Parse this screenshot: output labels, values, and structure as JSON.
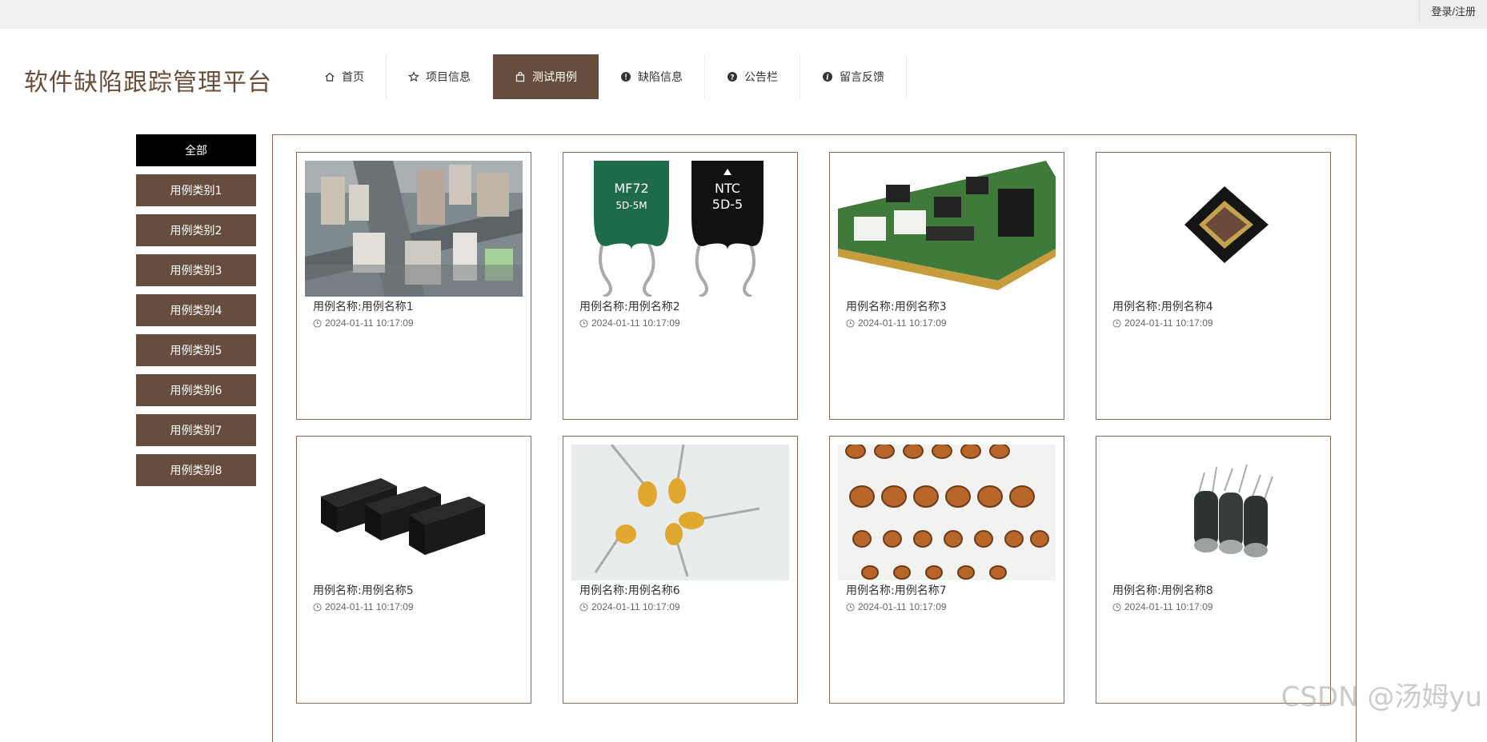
{
  "topbar": {
    "login_label": "登录/注册"
  },
  "site": {
    "title": "软件缺陷跟踪管理平台"
  },
  "nav": [
    {
      "label": "首页",
      "icon": "home-icon"
    },
    {
      "label": "项目信息",
      "icon": "star-icon"
    },
    {
      "label": "测试用例",
      "icon": "bag-icon",
      "active": true
    },
    {
      "label": "缺陷信息",
      "icon": "alert-icon"
    },
    {
      "label": "公告栏",
      "icon": "question-icon"
    },
    {
      "label": "留言反馈",
      "icon": "info-icon"
    }
  ],
  "sidebar": {
    "items": [
      {
        "label": "全部",
        "active": true
      },
      {
        "label": "用例类别1"
      },
      {
        "label": "用例类别2"
      },
      {
        "label": "用例类别3"
      },
      {
        "label": "用例类别4"
      },
      {
        "label": "用例类别5"
      },
      {
        "label": "用例类别6"
      },
      {
        "label": "用例类别7"
      },
      {
        "label": "用例类别8"
      }
    ]
  },
  "cards": [
    {
      "name": "用例名称:用例名称1",
      "time": "2024-01-11 10:17:09",
      "image": "city-aerial-photo"
    },
    {
      "name": "用例名称:用例名称2",
      "time": "2024-01-11 10:17:09",
      "image": "thermistor-photo",
      "image_text": [
        "MF72",
        "5D-5M",
        "NTC",
        "5D-5"
      ]
    },
    {
      "name": "用例名称:用例名称3",
      "time": "2024-01-11 10:17:09",
      "image": "circuit-board-photo"
    },
    {
      "name": "用例名称:用例名称4",
      "time": "2024-01-11 10:17:09",
      "image": "image-sensor-chip-photo"
    },
    {
      "name": "用例名称:用例名称5",
      "time": "2024-01-11 10:17:09",
      "image": "transformer-modules-photo"
    },
    {
      "name": "用例名称:用例名称6",
      "time": "2024-01-11 10:17:09",
      "image": "tantalum-capacitors-photo"
    },
    {
      "name": "用例名称:用例名称7",
      "time": "2024-01-11 10:17:09",
      "image": "toroid-inductors-photo"
    },
    {
      "name": "用例名称:用例名称8",
      "time": "2024-01-11 10:17:09",
      "image": "electrolytic-capacitors-photo"
    }
  ],
  "watermark": "CSDN @汤姆yu",
  "colors": {
    "accent": "#664d3e",
    "active_sidebar": "#000000",
    "title": "#6a4e3a",
    "border": "#8a6a55"
  }
}
